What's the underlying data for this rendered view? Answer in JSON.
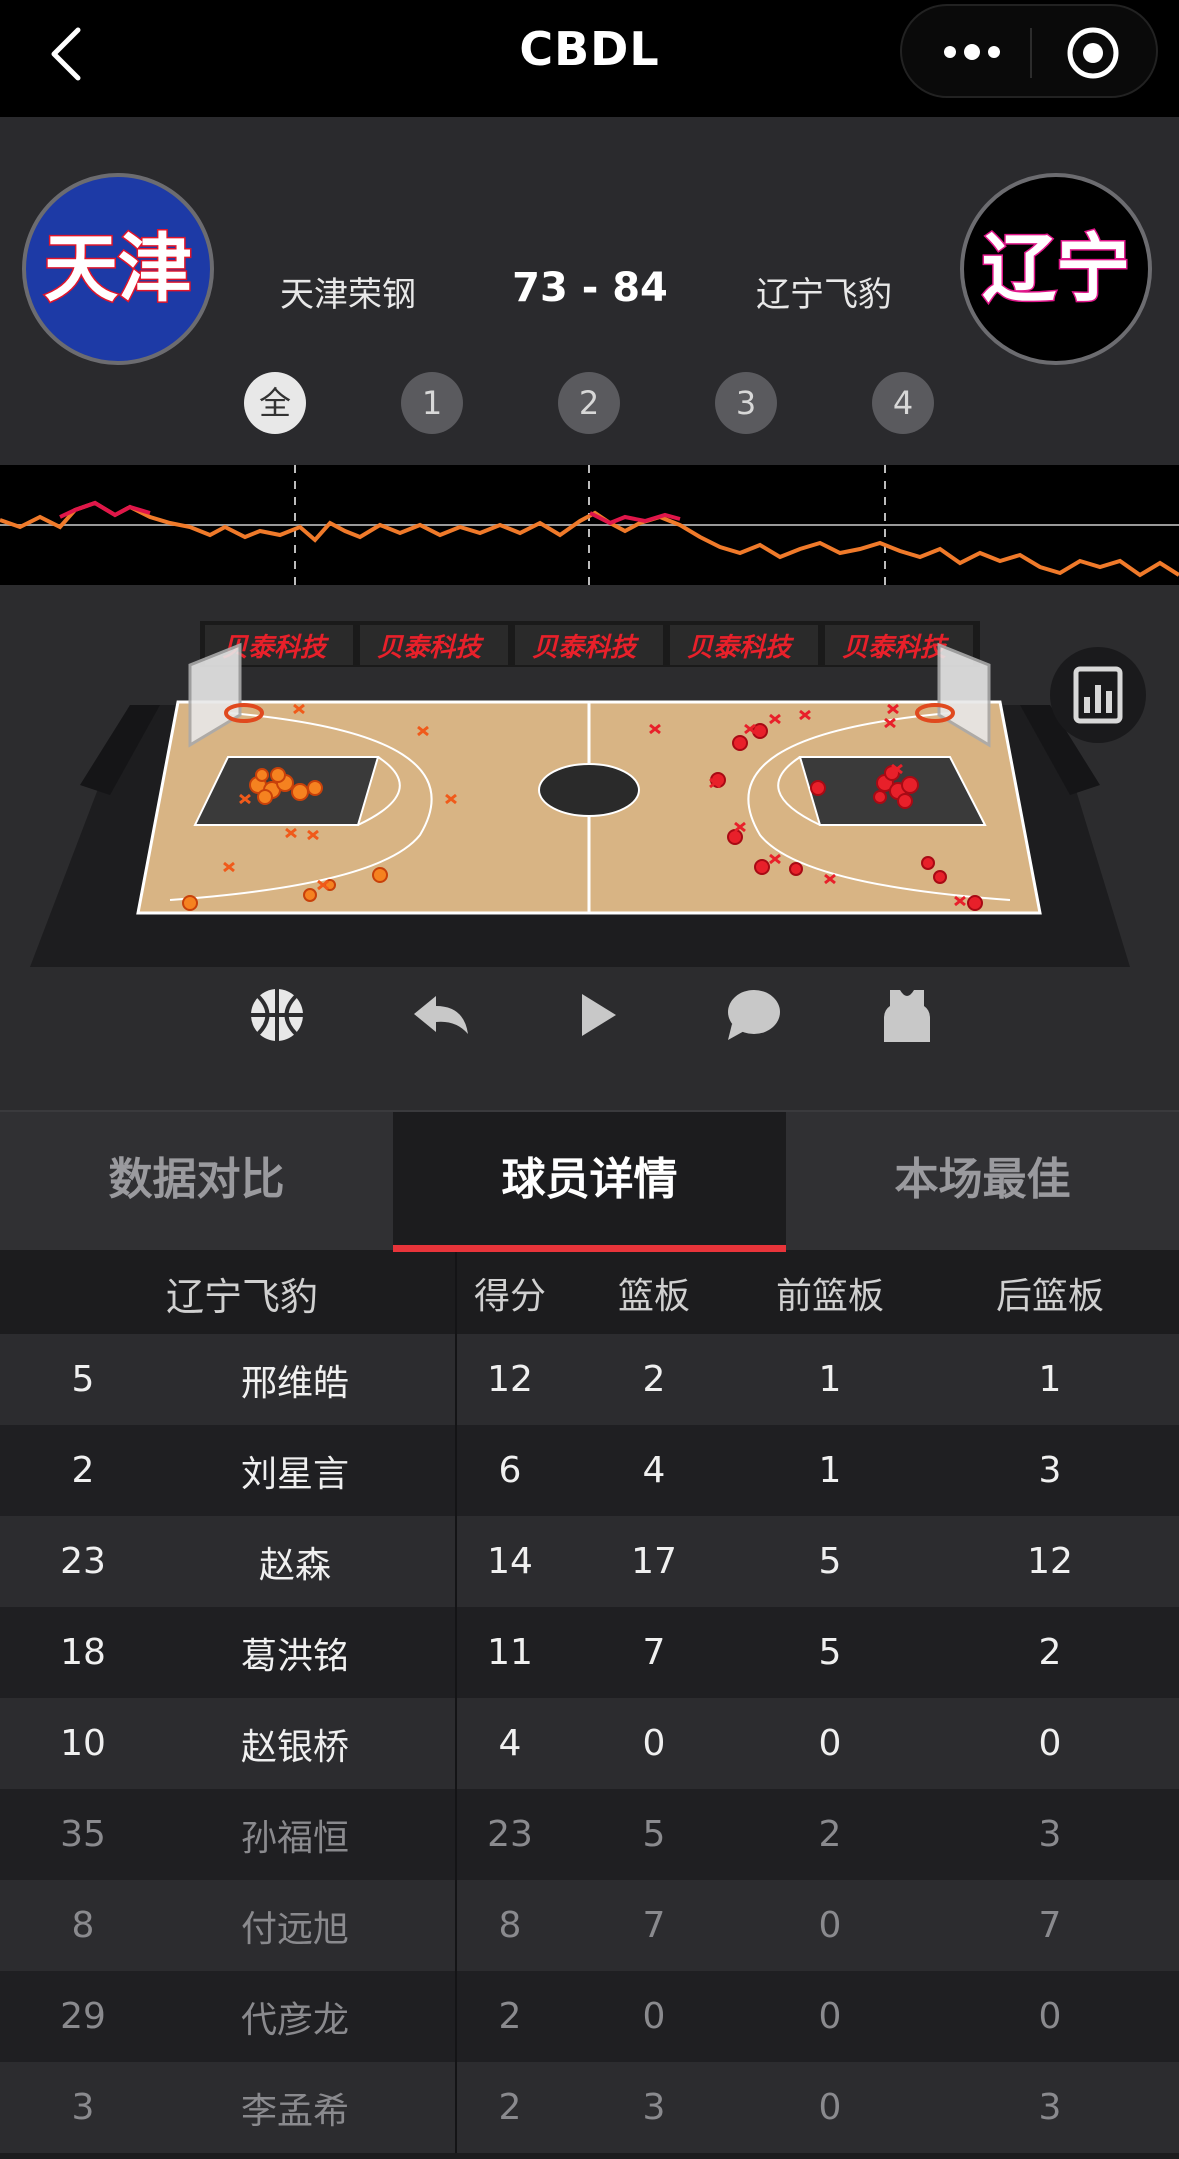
{
  "app": {
    "title": "CBDL"
  },
  "game": {
    "home_logo_text": "天津",
    "away_logo_text": "辽宁",
    "home_team": "天津荣钢",
    "away_team": "辽宁飞豹",
    "score_display": "73 - 84",
    "home_score": 73,
    "away_score": 84,
    "home_logo_color": "#1d3aa6",
    "away_logo_color": "#000000"
  },
  "quarters": [
    {
      "label": "全",
      "active": true
    },
    {
      "label": "1",
      "active": false
    },
    {
      "label": "2",
      "active": false
    },
    {
      "label": "3",
      "active": false
    },
    {
      "label": "4",
      "active": false
    }
  ],
  "court": {
    "sponsor_text": "贝泰科技"
  },
  "tabs": [
    {
      "label": "数据对比",
      "active": false
    },
    {
      "label": "球员详情",
      "active": true
    },
    {
      "label": "本场最佳",
      "active": false
    }
  ],
  "stats_table": {
    "team": "辽宁飞豹",
    "headers": [
      "得分",
      "篮板",
      "前篮板",
      "后篮板"
    ],
    "rows": [
      {
        "num": "5",
        "name": "邢维皓",
        "pts": "12",
        "reb": "2",
        "oreb": "1",
        "dreb": "1",
        "starter": true
      },
      {
        "num": "2",
        "name": "刘星言",
        "pts": "6",
        "reb": "4",
        "oreb": "1",
        "dreb": "3",
        "starter": true
      },
      {
        "num": "23",
        "name": "赵森",
        "pts": "14",
        "reb": "17",
        "oreb": "5",
        "dreb": "12",
        "starter": true
      },
      {
        "num": "18",
        "name": "葛洪铭",
        "pts": "11",
        "reb": "7",
        "oreb": "5",
        "dreb": "2",
        "starter": true
      },
      {
        "num": "10",
        "name": "赵银桥",
        "pts": "4",
        "reb": "0",
        "oreb": "0",
        "dreb": "0",
        "starter": true
      },
      {
        "num": "35",
        "name": "孙福恒",
        "pts": "23",
        "reb": "5",
        "oreb": "2",
        "dreb": "3",
        "starter": false
      },
      {
        "num": "8",
        "name": "付远旭",
        "pts": "8",
        "reb": "7",
        "oreb": "0",
        "dreb": "7",
        "starter": false
      },
      {
        "num": "29",
        "name": "代彦龙",
        "pts": "2",
        "reb": "0",
        "oreb": "0",
        "dreb": "0",
        "starter": false
      },
      {
        "num": "3",
        "name": "李孟希",
        "pts": "2",
        "reb": "3",
        "oreb": "0",
        "dreb": "3",
        "starter": false
      }
    ]
  },
  "colors": {
    "accent": "#e8343a",
    "team_label": "#f07a2a",
    "home_trend": "#f07a2a",
    "away_trend": "#e0164a"
  }
}
